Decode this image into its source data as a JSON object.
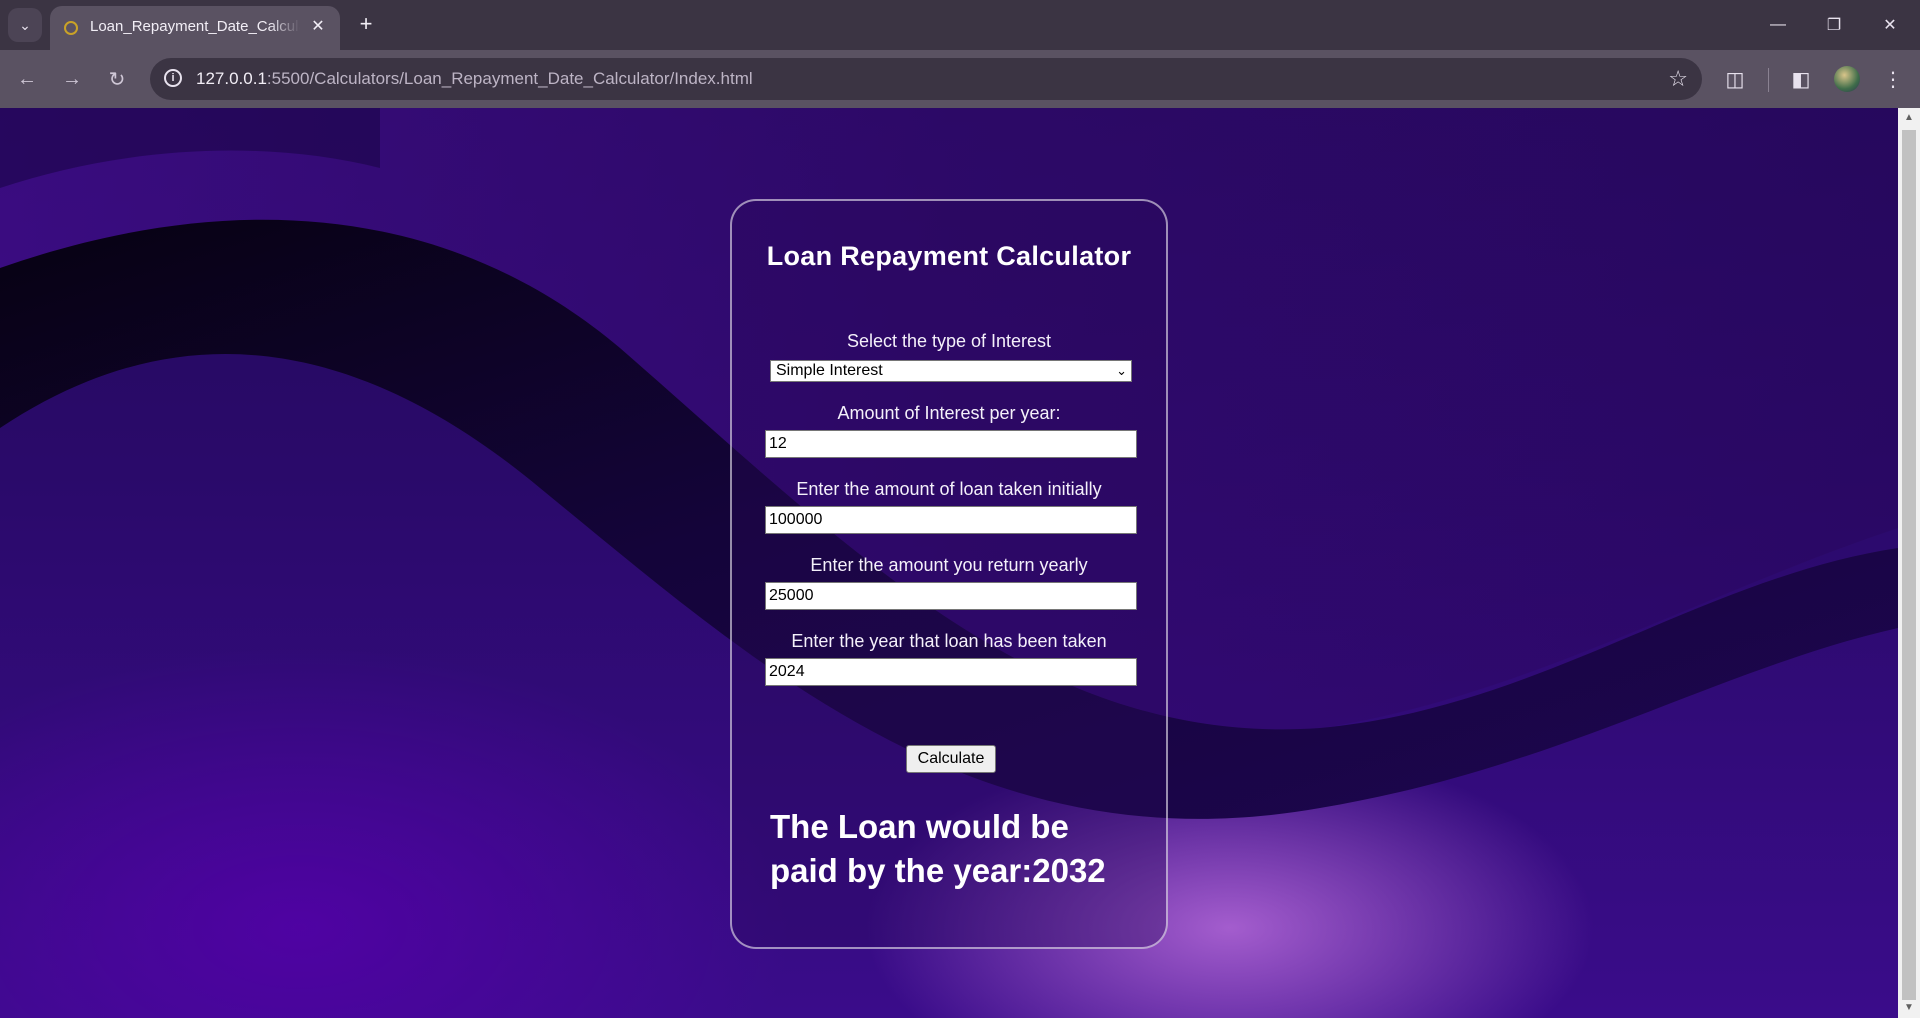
{
  "browser": {
    "tab_title": "Loan_Repayment_Date_Calculator",
    "url_host": "127.0.0.1",
    "url_path": ":5500/Calculators/Loan_Repayment_Date_Calculator/Index.html"
  },
  "calculator": {
    "title": "Loan Repayment Calculator",
    "interest_type_label": "Select the type of Interest",
    "interest_type_selected": "Simple Interest",
    "interest_rate_label": "Amount of Interest per year:",
    "interest_rate_value": "12",
    "loan_amount_label": "Enter the amount of loan taken initially",
    "loan_amount_value": "100000",
    "yearly_return_label": "Enter the amount you return yearly",
    "yearly_return_value": "25000",
    "loan_year_label": "Enter the year that loan has been taken",
    "loan_year_value": "2024",
    "calculate_label": "Calculate",
    "result_text": "The Loan would be paid by the year:2032"
  },
  "colors": {
    "accent_background": "#2a0a6a",
    "highlight": "#c878e6"
  }
}
